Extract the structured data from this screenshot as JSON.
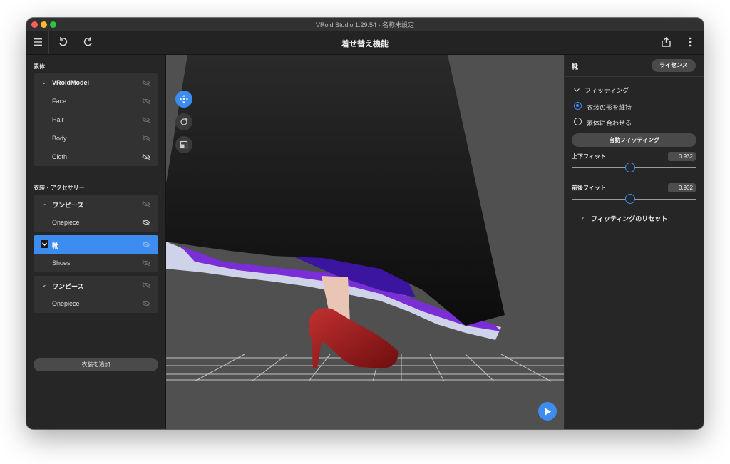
{
  "window": {
    "title": "VRoid Studio 1.29.54 - 名称未設定"
  },
  "toolbar": {
    "page_title": "着せ替え機能",
    "icons": [
      "menu-icon",
      "undo-icon",
      "redo-icon",
      "share-icon",
      "more-icon"
    ]
  },
  "left_panel": {
    "base_section_label": "素体",
    "base_group": {
      "header": "VRoidModel",
      "items": [
        "Face",
        "Hair",
        "Body",
        "Cloth"
      ]
    },
    "outfit_section_label": "衣装・アクセサリー",
    "outfit_groups": [
      {
        "header": "ワンピース",
        "items": [
          "Onepiece"
        ]
      },
      {
        "header": "靴",
        "items": [
          "Shoes"
        ],
        "selected": true
      },
      {
        "header": "ワンピース",
        "items": [
          "Onepiece"
        ]
      }
    ],
    "add_button": "衣装を追加"
  },
  "viewport": {
    "tools": [
      "move-icon",
      "rotate-icon",
      "scale-icon"
    ],
    "play": "play-icon"
  },
  "right_panel": {
    "title": "靴",
    "license_button": "ライセンス",
    "fitting_header": "フィッティング",
    "radio_options": [
      {
        "label": "衣装の形を維持",
        "checked": true
      },
      {
        "label": "素体に合わせる",
        "checked": false
      }
    ],
    "auto_fit_button": "自動フィッティング",
    "sliders": [
      {
        "label": "上下フィット",
        "value": "0.932",
        "position": 0.47
      },
      {
        "label": "前後フィット",
        "value": "0.932",
        "position": 0.47
      }
    ],
    "reset_label": "フィッティングのリセット"
  },
  "colors": {
    "accent": "#3d8cf0",
    "panel": "#262626",
    "viewport": "#505050"
  }
}
